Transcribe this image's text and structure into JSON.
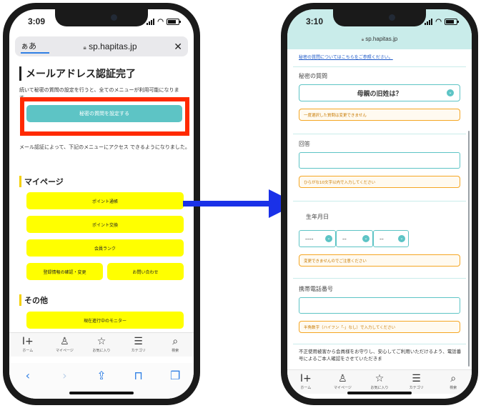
{
  "left": {
    "time": "3:09",
    "url": {
      "aa": "ぁあ",
      "domain": "sp.hapitas.jp",
      "close": "✕"
    },
    "title": "メールアドレス認証完了",
    "intro_text": "続いて秘密の質問の設定を行うと、全てのメニューが利用可能になります。",
    "secret_button": "秘密の質問を設定する",
    "access_text": "メール認証によって、下記のメニューにアクセス できるようになりました。",
    "mypage_heading": "マイページ",
    "mypage_buttons": [
      "ポイント通帳",
      "ポイント交換",
      "会員ランク",
      "登録情報の確認・変更",
      "お問い合わせ"
    ],
    "other_heading": "その他",
    "monitor_button": "現在進行中のモニター",
    "tabs": [
      {
        "icon": "home-icon",
        "label": "ホーム"
      },
      {
        "icon": "person-icon",
        "label": "マイページ"
      },
      {
        "icon": "star-icon",
        "label": "お気に入り"
      },
      {
        "icon": "list-icon",
        "label": "カテゴリ"
      },
      {
        "icon": "search-icon",
        "label": "検索"
      }
    ]
  },
  "right": {
    "time": "3:10",
    "domain": "sp.hapitas.jp",
    "secret_link": "秘密の質問についてはこちらをご参照ください。",
    "question_label": "秘密の質問",
    "question_value": "母親の旧姓は？",
    "question_note": "一度選択した質問は変更できません",
    "answer_label": "回答",
    "answer_note": "ひらがな10文字以内で入力してください",
    "birthday_label": "生年月日",
    "birthday_year": "----",
    "birthday_month": "--",
    "birthday_day": "--",
    "birthday_note": "変更できませんのでご注意ください",
    "phone_label": "携帯電話番号",
    "phone_note": "半角数字（ハイフン「-」なし）で入力してください",
    "footer_text": "不正使用被害から会員様をお守りし、安心してご利用いただけるよう、電話番号によるご本人確認をさせていただきま",
    "tabs": [
      {
        "icon": "home-icon",
        "label": "ホーム"
      },
      {
        "icon": "person-icon",
        "label": "マイページ"
      },
      {
        "icon": "star-icon",
        "label": "お気に入り"
      },
      {
        "icon": "list-icon",
        "label": "カテゴリ"
      },
      {
        "icon": "search-icon",
        "label": "検索"
      }
    ]
  },
  "colors": {
    "teal": "#5dc4c5",
    "yellow": "#ffff00",
    "highlight_red": "#ff2a00",
    "arrow_blue": "#1a31e8"
  }
}
